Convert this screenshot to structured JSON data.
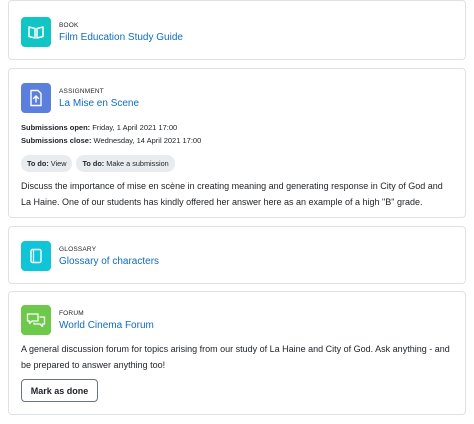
{
  "activities": [
    {
      "type": "BOOK",
      "title": "Film Education Study Guide",
      "icon": "book-icon",
      "color": "#11c5c5"
    },
    {
      "type": "ASSIGNMENT",
      "title": "La Mise en Scene",
      "icon": "assignment-upload-icon",
      "color": "#5b7fdc",
      "dates": [
        {
          "label": "Submissions open:",
          "value": "Friday, 1 April 2021 17:00"
        },
        {
          "label": "Submissions close:",
          "value": "Wednesday, 14 April 2021 17:00"
        }
      ],
      "todos": [
        {
          "label": "To do:",
          "value": "View"
        },
        {
          "label": "To do:",
          "value": "Make a submission"
        }
      ],
      "description": "Discuss the importance of  mise en scène in creating meaning and generating response in City of God and La Haine. One of our students has kindly offered her answer here as an example of a high \"B\" grade."
    },
    {
      "type": "GLOSSARY",
      "title": "Glossary of characters",
      "icon": "glossary-icon",
      "color": "#11c5d8"
    },
    {
      "type": "FORUM",
      "title": "World Cinema Forum",
      "icon": "forum-icon",
      "color": "#6cc94a",
      "description": "A general discussion forum for topics arising from our study of La Haine and City of God. Ask anything - and be prepared to answer anything too!",
      "button": "Mark as done"
    }
  ]
}
